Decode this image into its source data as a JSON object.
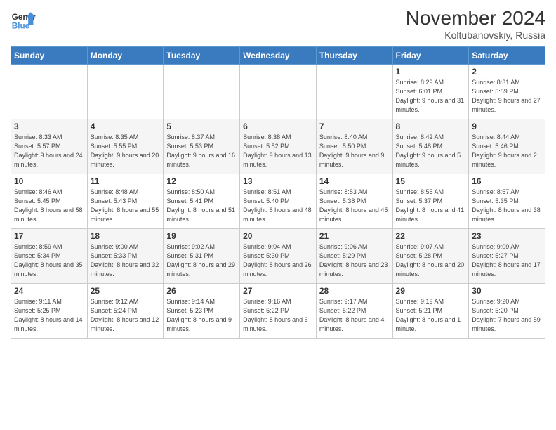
{
  "header": {
    "logo_line1": "General",
    "logo_line2": "Blue",
    "month": "November 2024",
    "location": "Koltubanovskiy, Russia"
  },
  "days_of_week": [
    "Sunday",
    "Monday",
    "Tuesday",
    "Wednesday",
    "Thursday",
    "Friday",
    "Saturday"
  ],
  "weeks": [
    [
      {
        "day": "",
        "info": ""
      },
      {
        "day": "",
        "info": ""
      },
      {
        "day": "",
        "info": ""
      },
      {
        "day": "",
        "info": ""
      },
      {
        "day": "",
        "info": ""
      },
      {
        "day": "1",
        "info": "Sunrise: 8:29 AM\nSunset: 6:01 PM\nDaylight: 9 hours and 31 minutes."
      },
      {
        "day": "2",
        "info": "Sunrise: 8:31 AM\nSunset: 5:59 PM\nDaylight: 9 hours and 27 minutes."
      }
    ],
    [
      {
        "day": "3",
        "info": "Sunrise: 8:33 AM\nSunset: 5:57 PM\nDaylight: 9 hours and 24 minutes."
      },
      {
        "day": "4",
        "info": "Sunrise: 8:35 AM\nSunset: 5:55 PM\nDaylight: 9 hours and 20 minutes."
      },
      {
        "day": "5",
        "info": "Sunrise: 8:37 AM\nSunset: 5:53 PM\nDaylight: 9 hours and 16 minutes."
      },
      {
        "day": "6",
        "info": "Sunrise: 8:38 AM\nSunset: 5:52 PM\nDaylight: 9 hours and 13 minutes."
      },
      {
        "day": "7",
        "info": "Sunrise: 8:40 AM\nSunset: 5:50 PM\nDaylight: 9 hours and 9 minutes."
      },
      {
        "day": "8",
        "info": "Sunrise: 8:42 AM\nSunset: 5:48 PM\nDaylight: 9 hours and 5 minutes."
      },
      {
        "day": "9",
        "info": "Sunrise: 8:44 AM\nSunset: 5:46 PM\nDaylight: 9 hours and 2 minutes."
      }
    ],
    [
      {
        "day": "10",
        "info": "Sunrise: 8:46 AM\nSunset: 5:45 PM\nDaylight: 8 hours and 58 minutes."
      },
      {
        "day": "11",
        "info": "Sunrise: 8:48 AM\nSunset: 5:43 PM\nDaylight: 8 hours and 55 minutes."
      },
      {
        "day": "12",
        "info": "Sunrise: 8:50 AM\nSunset: 5:41 PM\nDaylight: 8 hours and 51 minutes."
      },
      {
        "day": "13",
        "info": "Sunrise: 8:51 AM\nSunset: 5:40 PM\nDaylight: 8 hours and 48 minutes."
      },
      {
        "day": "14",
        "info": "Sunrise: 8:53 AM\nSunset: 5:38 PM\nDaylight: 8 hours and 45 minutes."
      },
      {
        "day": "15",
        "info": "Sunrise: 8:55 AM\nSunset: 5:37 PM\nDaylight: 8 hours and 41 minutes."
      },
      {
        "day": "16",
        "info": "Sunrise: 8:57 AM\nSunset: 5:35 PM\nDaylight: 8 hours and 38 minutes."
      }
    ],
    [
      {
        "day": "17",
        "info": "Sunrise: 8:59 AM\nSunset: 5:34 PM\nDaylight: 8 hours and 35 minutes."
      },
      {
        "day": "18",
        "info": "Sunrise: 9:00 AM\nSunset: 5:33 PM\nDaylight: 8 hours and 32 minutes."
      },
      {
        "day": "19",
        "info": "Sunrise: 9:02 AM\nSunset: 5:31 PM\nDaylight: 8 hours and 29 minutes."
      },
      {
        "day": "20",
        "info": "Sunrise: 9:04 AM\nSunset: 5:30 PM\nDaylight: 8 hours and 26 minutes."
      },
      {
        "day": "21",
        "info": "Sunrise: 9:06 AM\nSunset: 5:29 PM\nDaylight: 8 hours and 23 minutes."
      },
      {
        "day": "22",
        "info": "Sunrise: 9:07 AM\nSunset: 5:28 PM\nDaylight: 8 hours and 20 minutes."
      },
      {
        "day": "23",
        "info": "Sunrise: 9:09 AM\nSunset: 5:27 PM\nDaylight: 8 hours and 17 minutes."
      }
    ],
    [
      {
        "day": "24",
        "info": "Sunrise: 9:11 AM\nSunset: 5:25 PM\nDaylight: 8 hours and 14 minutes."
      },
      {
        "day": "25",
        "info": "Sunrise: 9:12 AM\nSunset: 5:24 PM\nDaylight: 8 hours and 12 minutes."
      },
      {
        "day": "26",
        "info": "Sunrise: 9:14 AM\nSunset: 5:23 PM\nDaylight: 8 hours and 9 minutes."
      },
      {
        "day": "27",
        "info": "Sunrise: 9:16 AM\nSunset: 5:22 PM\nDaylight: 8 hours and 6 minutes."
      },
      {
        "day": "28",
        "info": "Sunrise: 9:17 AM\nSunset: 5:22 PM\nDaylight: 8 hours and 4 minutes."
      },
      {
        "day": "29",
        "info": "Sunrise: 9:19 AM\nSunset: 5:21 PM\nDaylight: 8 hours and 1 minute."
      },
      {
        "day": "30",
        "info": "Sunrise: 9:20 AM\nSunset: 5:20 PM\nDaylight: 7 hours and 59 minutes."
      }
    ]
  ]
}
